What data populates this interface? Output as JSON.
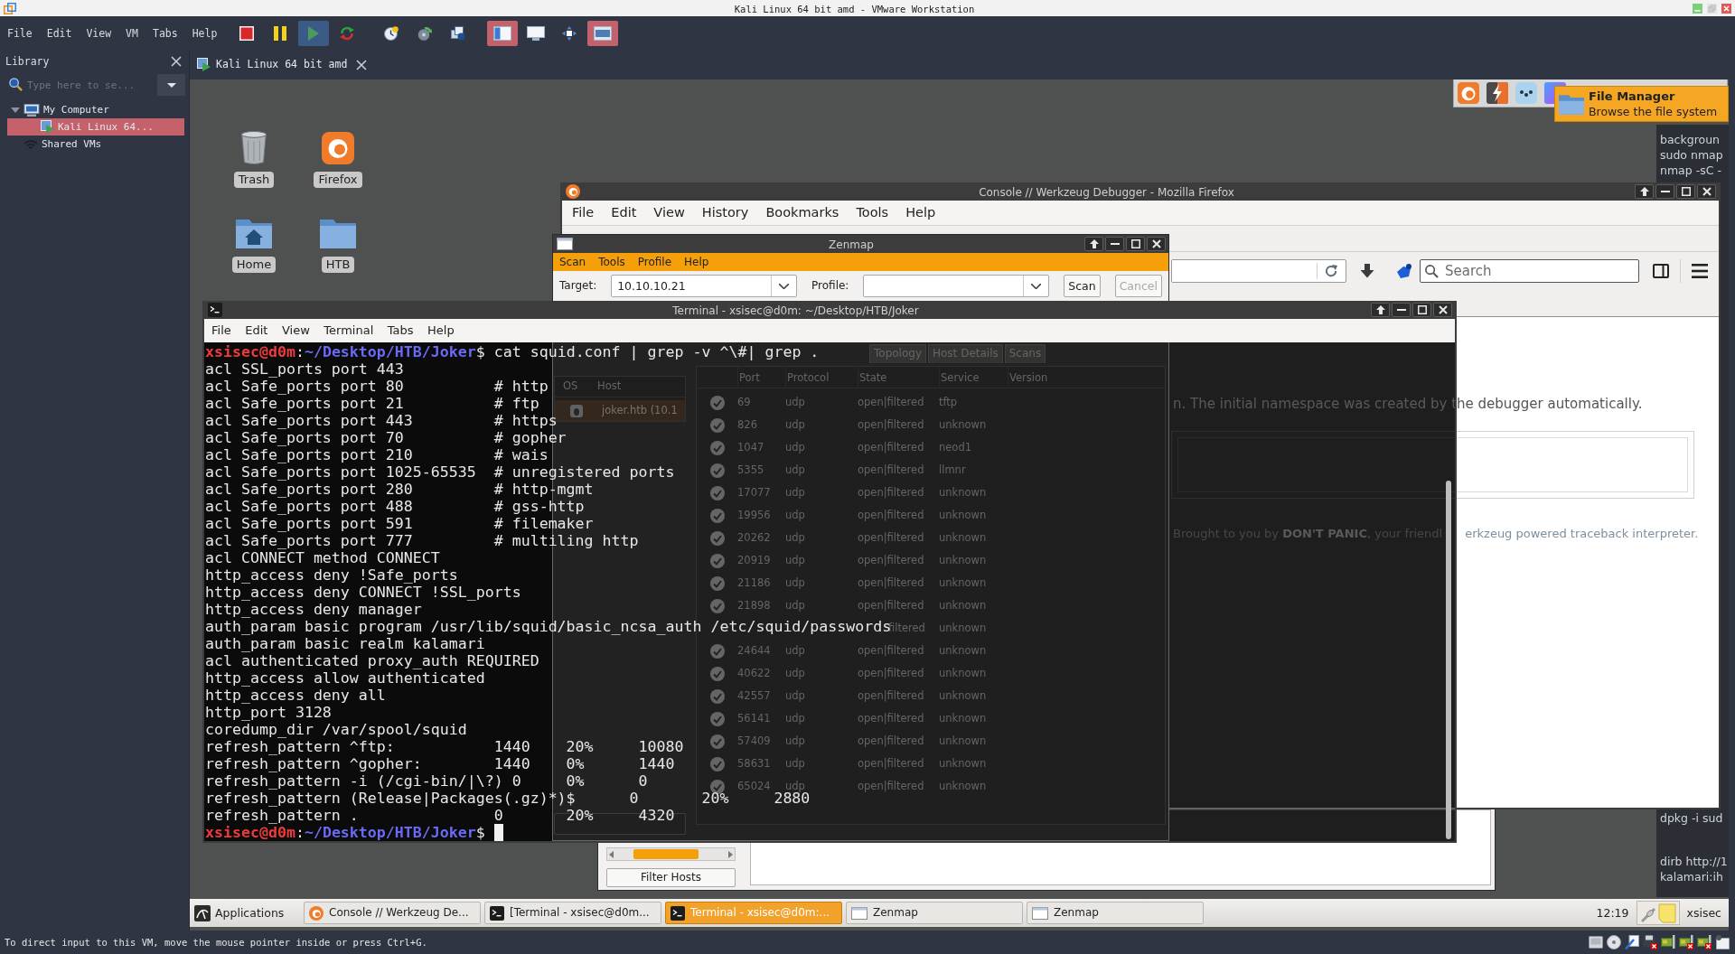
{
  "vmware": {
    "title": "Kali Linux 64 bit amd - VMware Workstation",
    "menu": [
      "File",
      "Edit",
      "View",
      "VM",
      "Tabs",
      "Help"
    ],
    "toolbar": [
      {
        "kind": "stop",
        "pressed": false,
        "toggled": false
      },
      {
        "kind": "pause",
        "pressed": false,
        "toggled": false
      },
      {
        "kind": "play",
        "pressed": true,
        "toggled": false
      },
      {
        "kind": "reset",
        "pressed": false,
        "toggled": false
      },
      {
        "kind": "snapshot",
        "pressed": false,
        "toggled": false
      },
      {
        "kind": "revert",
        "pressed": false,
        "toggled": false
      },
      {
        "kind": "snapshots",
        "pressed": false,
        "toggled": false
      },
      {
        "kind": "sidebar",
        "pressed": false,
        "toggled": true
      },
      {
        "kind": "fullscreen",
        "pressed": false,
        "toggled": false
      },
      {
        "kind": "unity",
        "pressed": false,
        "toggled": false
      },
      {
        "kind": "thumbnails",
        "pressed": false,
        "toggled": true
      }
    ],
    "status": "To direct input to this VM, move the mouse pointer inside or press Ctrl+G.",
    "tray": [
      {
        "kind": "disk",
        "disconnected": false
      },
      {
        "kind": "cd",
        "disconnected": false
      },
      {
        "kind": "pen",
        "disconnected": false
      },
      {
        "kind": "floppy",
        "disconnected": true
      },
      {
        "kind": "card",
        "disconnected": false
      },
      {
        "kind": "card",
        "disconnected": true
      },
      {
        "kind": "card",
        "disconnected": true
      },
      {
        "kind": "note",
        "disconnected": false
      }
    ]
  },
  "library": {
    "title": "Library",
    "search": {
      "placeholder": "Type here to se..."
    },
    "tree": [
      {
        "label": "My Computer",
        "kind": "computer",
        "selected": false,
        "expanded": true,
        "children": [
          {
            "label": "Kali Linux 64...",
            "kind": "vm",
            "selected": true
          }
        ]
      },
      {
        "label": "Shared VMs",
        "kind": "shared",
        "selected": false
      }
    ]
  },
  "vm_tab": {
    "label": "Kali Linux 64 bit amd"
  },
  "desktop": {
    "icons": [
      {
        "label": "Trash",
        "kind": "trash"
      },
      {
        "label": "Firefox",
        "kind": "browser"
      },
      {
        "label": "Home",
        "kind": "home"
      },
      {
        "label": "HTB",
        "kind": "folder"
      }
    ]
  },
  "side_terminal": {
    "top_lines": [
      "backgroun",
      "sudo nmap",
      "nmap -sC -"
    ],
    "middle_lines": [
      "dpkg -i sud"
    ],
    "bottom_lines": [
      "dirb http://1",
      "kalamari:ih"
    ]
  },
  "firefox": {
    "title": "Console // Werkzeug Debugger - Mozilla Firefox",
    "menu": [
      "File",
      "Edit",
      "View",
      "History",
      "Bookmarks",
      "Tools",
      "Help"
    ],
    "search": {
      "placeholder": "Search"
    },
    "intro": "n. The initial namespace was created by the debugger automatically.",
    "footer": {
      "text": "Brought to you by **DON'T PANIC**, your friendl",
      "link": "erkzeug powered traceback interpreter",
      "end": "."
    }
  },
  "zenmap": {
    "title": "Zenmap",
    "menu": [
      "Scan",
      "Tools",
      "Profile",
      "Help"
    ],
    "target": {
      "label": "Target:",
      "value": "10.10.10.21"
    },
    "profile": {
      "label": "Profile:"
    },
    "buttons": [
      {
        "label": "Scan",
        "disabled": false
      },
      {
        "label": "Cancel",
        "disabled": true
      }
    ],
    "host_columns": [
      "OS",
      "Host"
    ],
    "hosts": [
      {
        "name": "joker.htb (10.1",
        "selected": true
      }
    ],
    "tabs": [
      {
        "label": "Topology",
        "selected": false
      },
      {
        "label": "Host Details",
        "selected": false
      },
      {
        "label": "Scans",
        "selected": false
      }
    ],
    "port_columns": [
      "Port",
      "Protocol",
      "State",
      "Service",
      "Version"
    ],
    "ports": [
      {
        "port": "69",
        "protocol": "udp",
        "state": "open|filtered",
        "service": "tftp"
      },
      {
        "port": "826",
        "protocol": "udp",
        "state": "open|filtered",
        "service": "unknown"
      },
      {
        "port": "1047",
        "protocol": "udp",
        "state": "open|filtered",
        "service": "neod1"
      },
      {
        "port": "5355",
        "protocol": "udp",
        "state": "open|filtered",
        "service": "llmnr"
      },
      {
        "port": "17077",
        "protocol": "udp",
        "state": "open|filtered",
        "service": "unknown"
      },
      {
        "port": "19956",
        "protocol": "udp",
        "state": "open|filtered",
        "service": "unknown"
      },
      {
        "port": "20262",
        "protocol": "udp",
        "state": "open|filtered",
        "service": "unknown"
      },
      {
        "port": "20919",
        "protocol": "udp",
        "state": "open|filtered",
        "service": "unknown"
      },
      {
        "port": "21186",
        "protocol": "udp",
        "state": "open|filtered",
        "service": "unknown"
      },
      {
        "port": "21898",
        "protocol": "udp",
        "state": "open|filtered",
        "service": "unknown"
      },
      {
        "state": "filtered",
        "service": "unknown"
      },
      {
        "port": "24644",
        "protocol": "udp",
        "state": "open|filtered",
        "service": "unknown"
      },
      {
        "port": "40622",
        "protocol": "udp",
        "state": "open|filtered",
        "service": "unknown"
      },
      {
        "port": "42557",
        "protocol": "udp",
        "state": "open|filtered",
        "service": "unknown"
      },
      {
        "port": "56141",
        "protocol": "udp",
        "state": "open|filtered",
        "service": "unknown"
      },
      {
        "port": "57409",
        "protocol": "udp",
        "state": "open|filtered",
        "service": "unknown"
      },
      {
        "port": "58631",
        "protocol": "udp",
        "state": "open|filtered",
        "service": "unknown"
      },
      {
        "port": "65024",
        "protocol": "udp",
        "state": "open|filtered",
        "service": "unknown"
      }
    ]
  },
  "zenmap_behind": {
    "filter_button": "Filter Hosts"
  },
  "terminal": {
    "title": "Terminal - xsisec@d0m: ~/Desktop/HTB/Joker",
    "menu": [
      "File",
      "Edit",
      "View",
      "Terminal",
      "Tabs",
      "Help"
    ],
    "lines": [
      {
        "kind": "prompt",
        "user": "xsisec@d0m",
        "separator": ":",
        "path": "~/Desktop/HTB/Joker",
        "symbol": "$",
        "command": "cat squid.conf | grep -v ^\\#| grep .",
        "cursor": false
      },
      {
        "kind": "output",
        "text": "acl SSL_ports port 443"
      },
      {
        "kind": "output",
        "text": "acl Safe_ports port 80          # http"
      },
      {
        "kind": "output",
        "text": "acl Safe_ports port 21          # ftp"
      },
      {
        "kind": "output",
        "text": "acl Safe_ports port 443         # https"
      },
      {
        "kind": "output",
        "text": "acl Safe_ports port 70          # gopher"
      },
      {
        "kind": "output",
        "text": "acl Safe_ports port 210         # wais"
      },
      {
        "kind": "output",
        "text": "acl Safe_ports port 1025-65535  # unregistered ports"
      },
      {
        "kind": "output",
        "text": "acl Safe_ports port 280         # http-mgmt"
      },
      {
        "kind": "output",
        "text": "acl Safe_ports port 488         # gss-http"
      },
      {
        "kind": "output",
        "text": "acl Safe_ports port 591         # filemaker"
      },
      {
        "kind": "output",
        "text": "acl Safe_ports port 777         # multiling http"
      },
      {
        "kind": "output",
        "text": "acl CONNECT method CONNECT"
      },
      {
        "kind": "output",
        "text": "http_access deny !Safe_ports"
      },
      {
        "kind": "output",
        "text": "http_access deny CONNECT !SSL_ports"
      },
      {
        "kind": "output",
        "text": "http_access deny manager"
      },
      {
        "kind": "output",
        "text": "auth_param basic program /usr/lib/squid/basic_ncsa_auth /etc/squid/passwords"
      },
      {
        "kind": "output",
        "text": "auth_param basic realm kalamari"
      },
      {
        "kind": "output",
        "text": "acl authenticated proxy_auth REQUIRED"
      },
      {
        "kind": "output",
        "text": "http_access allow authenticated"
      },
      {
        "kind": "output",
        "text": "http_access deny all"
      },
      {
        "kind": "output",
        "text": "http_port 3128"
      },
      {
        "kind": "output",
        "text": "coredump_dir /var/spool/squid"
      },
      {
        "kind": "output",
        "text": "refresh_pattern ^ftp:           1440    20%     10080"
      },
      {
        "kind": "output",
        "text": "refresh_pattern ^gopher:        1440    0%      1440"
      },
      {
        "kind": "output",
        "text": "refresh_pattern -i (/cgi-bin/|\\?) 0     0%      0"
      },
      {
        "kind": "output",
        "text": "refresh_pattern (Release|Packages(.gz)*)$      0       20%     2880"
      },
      {
        "kind": "output",
        "text": "refresh_pattern .               0       20%     4320"
      },
      {
        "kind": "prompt",
        "user": "xsisec@d0m",
        "separator": ":",
        "path": "~/Desktop/HTB/Joker",
        "symbol": "$",
        "cursor": true
      }
    ]
  },
  "tooltip": {
    "title": "File Manager",
    "text": "Browse the file system"
  },
  "taskbar": {
    "menu_label": "Applications",
    "tasks": [
      {
        "label": "Console // Werkzeug De...",
        "kind": "browser",
        "selected": false
      },
      {
        "label": "[Terminal - xsisec@d0m...",
        "kind": "terminal",
        "selected": false
      },
      {
        "label": "Terminal - xsisec@d0m:...",
        "kind": "terminal",
        "selected": true
      },
      {
        "label": "Zenmap",
        "kind": "window",
        "selected": false
      },
      {
        "label": "Zenmap",
        "kind": "window",
        "selected": false
      }
    ],
    "clock": "12:19",
    "user": "xsisec"
  }
}
